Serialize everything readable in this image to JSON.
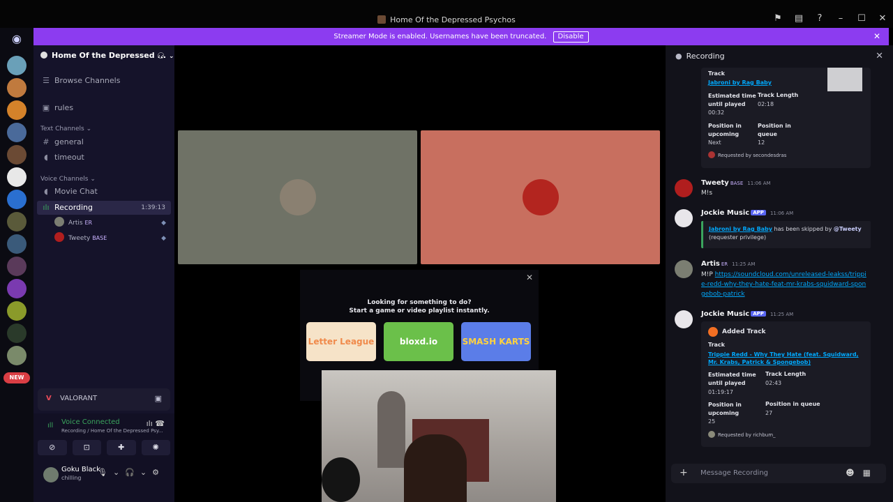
{
  "window": {
    "title": "Home Of the Depressed Psychos"
  },
  "banner": {
    "text": "Streamer Mode is enabled. Usernames have been truncated.",
    "disable_label": "Disable"
  },
  "server": {
    "name": "Home Of the Depressed ..."
  },
  "sidebar": {
    "browse_label": "Browse Channels",
    "rules_label": "rules",
    "text_category": "Text Channels",
    "text_channels": [
      "general",
      "timeout"
    ],
    "voice_category": "Voice Channels",
    "voice_channels": [
      "Movie Chat",
      "Recording"
    ],
    "recording_timer": "1:39:13",
    "voice_users": [
      {
        "name": "Artis",
        "tag": "ER"
      },
      {
        "name": "Tweety",
        "tag": "BASE"
      }
    ],
    "new_badge": "NEW"
  },
  "activity_status": {
    "game": "VALORANT"
  },
  "voice_connected": {
    "status": "Voice Connected",
    "subtitle": "Recording / Home Of the Depressed Psy..."
  },
  "user": {
    "name": "Goku Black",
    "status": "chilling"
  },
  "activity": {
    "line1": "Looking for something to do?",
    "line2": "Start a game or video playlist instantly.",
    "games": [
      "Letter League",
      "bloxd.io",
      "SMASH KARTS"
    ]
  },
  "right_panel": {
    "title": "Recording",
    "card1": {
      "track_label": "Track",
      "track_link": "Jabroni by Rag Baby",
      "est_label": "Estimated time until played",
      "est_value": "00:32",
      "length_label": "Track Length",
      "length_value": "02:18",
      "pos_up_label": "Position in upcoming",
      "pos_up_value": "Next",
      "pos_q_label": "Position in queue",
      "pos_q_value": "12",
      "requested": "Requested by secondesdras"
    },
    "messages": [
      {
        "author": "Tweety",
        "tag": "BASE",
        "time": "11:06 AM",
        "text": "M!s"
      },
      {
        "author": "Jockie Music",
        "badge": "APP",
        "time": "11:06 AM",
        "skip_link": "Jabroni by Rag Baby",
        "skip_text": " has been skipped by ",
        "skip_mention": "@Tweety",
        "skip_note": "(requester privilege)"
      },
      {
        "author": "Artis",
        "tag": "ER",
        "time": "11:25 AM",
        "prefix": "M!P ",
        "link": "https://soundcloud.com/unreleased-leakss/trippie-redd-why-they-hate-feat-mr-krabs-squidward-spongebob-patrick"
      },
      {
        "author": "Jockie Music",
        "badge": "APP",
        "time": "11:25 AM"
      }
    ],
    "card2": {
      "title": "Added Track",
      "track_label": "Track",
      "track_link": "Trippie Redd - Why They Hate (feat. Squidward, Mr. Krabs, Patrick & Spongebob)",
      "est_label": "Estimated time until played",
      "est_value": "01:19:17",
      "length_label": "Track Length",
      "length_value": "02:43",
      "pos_up_label": "Position in upcoming",
      "pos_up_value": "25",
      "pos_q_label": "Position in queue",
      "pos_q_value": "27",
      "requested": "Requested by richbum_"
    },
    "composer_placeholder": "Message Recording"
  },
  "colors": {
    "banner": "#8c3cf0",
    "tile_left": "#6f7266",
    "tile_right": "#c86f5f",
    "link": "#00a8fc",
    "online": "#3ba55d"
  }
}
